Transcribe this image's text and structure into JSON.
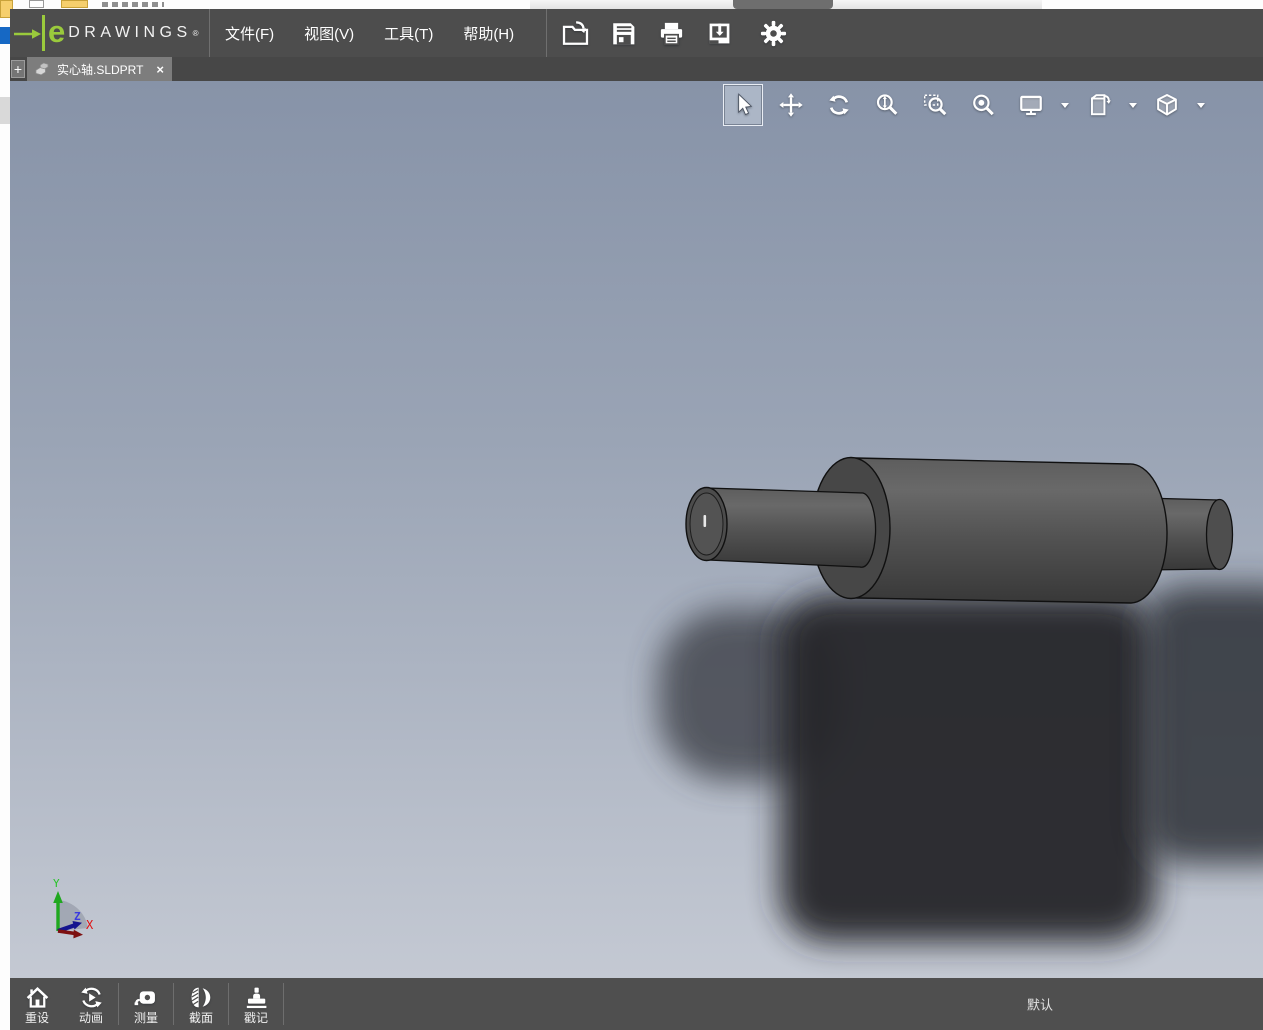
{
  "app": {
    "logo_e": "e",
    "logo_text": "DRAWINGS",
    "logo_reg": "®"
  },
  "menubar": {
    "items": [
      {
        "label": "文件(F)"
      },
      {
        "label": "视图(V)"
      },
      {
        "label": "工具(T)"
      },
      {
        "label": "帮助(H)"
      }
    ],
    "actions": [
      {
        "name": "open"
      },
      {
        "name": "save"
      },
      {
        "name": "print"
      },
      {
        "name": "package"
      },
      {
        "name": "settings"
      }
    ]
  },
  "tabbar": {
    "new_tab_label": "+",
    "tab": {
      "label": "实心轴.SLDPRT",
      "close_label": "×"
    }
  },
  "view_toolbar": {
    "tools": [
      {
        "name": "select",
        "selected": true
      },
      {
        "name": "pan"
      },
      {
        "name": "rotate"
      },
      {
        "name": "zoom"
      },
      {
        "name": "zoom-area"
      },
      {
        "name": "zoom-fit"
      },
      {
        "name": "fullscreen",
        "dropdown": true
      },
      {
        "name": "pages",
        "dropdown": true
      },
      {
        "name": "orientation-cube",
        "dropdown": true
      }
    ]
  },
  "viewport": {
    "triad": {
      "x_label": "X",
      "y_label": "Y",
      "z_label": "Z"
    }
  },
  "bottom_toolbar": {
    "tools": [
      {
        "label": "重设"
      },
      {
        "label": "动画"
      },
      {
        "label": "测量"
      },
      {
        "label": "截面"
      },
      {
        "label": "戳记"
      }
    ],
    "configuration_label": "默认"
  },
  "colors": {
    "accent_green": "#9aca3c",
    "toolbar_bg": "#4d4d4d",
    "tab_active_bg": "#7d7d7d",
    "viewport_top": "#8793a8",
    "viewport_bottom": "#c4c9d3",
    "model_gray": "#545454",
    "selection_blue": "#1668c4",
    "axis_x": "#d01414",
    "axis_y": "#1fbd1f",
    "axis_z": "#2a2ad0"
  }
}
